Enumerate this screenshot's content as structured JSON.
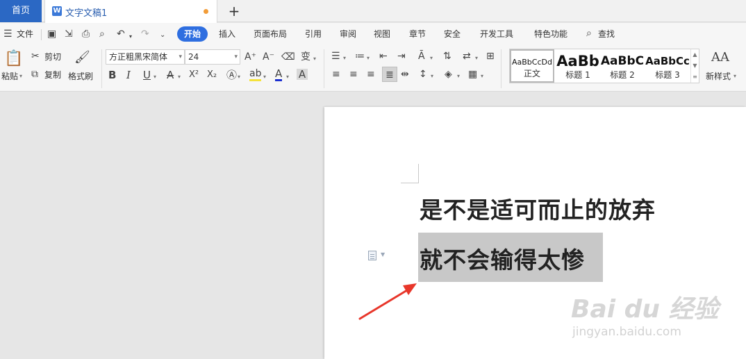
{
  "tabs": {
    "home": "首页",
    "document": "文字文稿1",
    "new_tab": "+"
  },
  "menu": {
    "file": "文件",
    "items": [
      "开始",
      "插入",
      "页面布局",
      "引用",
      "审阅",
      "视图",
      "章节",
      "安全",
      "开发工具",
      "特色功能"
    ],
    "search": "查找"
  },
  "ribbon": {
    "paste": "粘贴",
    "cut": "剪切",
    "copy": "复制",
    "format_painter": "格式刷",
    "font_name": "方正粗黑宋简体",
    "font_size": "24",
    "bold": "B",
    "italic": "I",
    "underline": "U",
    "strikethrough": "A",
    "superscript": "X²",
    "subscript": "X₂",
    "font_color_glyph": "A",
    "char_shading": "A",
    "highlight": "ab",
    "grow_font": "A⁺",
    "shrink_font": "A⁻",
    "phonetic": "变",
    "styles": [
      {
        "sample": "AaBbCcDd",
        "name": "正文"
      },
      {
        "sample": "AaBb",
        "name": "标题 1"
      },
      {
        "sample": "AaBbC",
        "name": "标题 2"
      },
      {
        "sample": "AaBbCc",
        "name": "标题 3"
      }
    ],
    "new_style": "新样式",
    "new_style_glyph": "AA"
  },
  "document": {
    "line1": "是不是适可而止的放弃",
    "line2": "就不会输得太惨"
  },
  "watermark": {
    "brand": "Bai du 经验",
    "url": "jingyan.baidu.com"
  },
  "colors": {
    "accent": "#2e6ee0",
    "home_tab": "#2b68c4",
    "unsaved_dot": "#f29c38",
    "selection": "#c8c8c8",
    "arrow": "#e8362a"
  }
}
